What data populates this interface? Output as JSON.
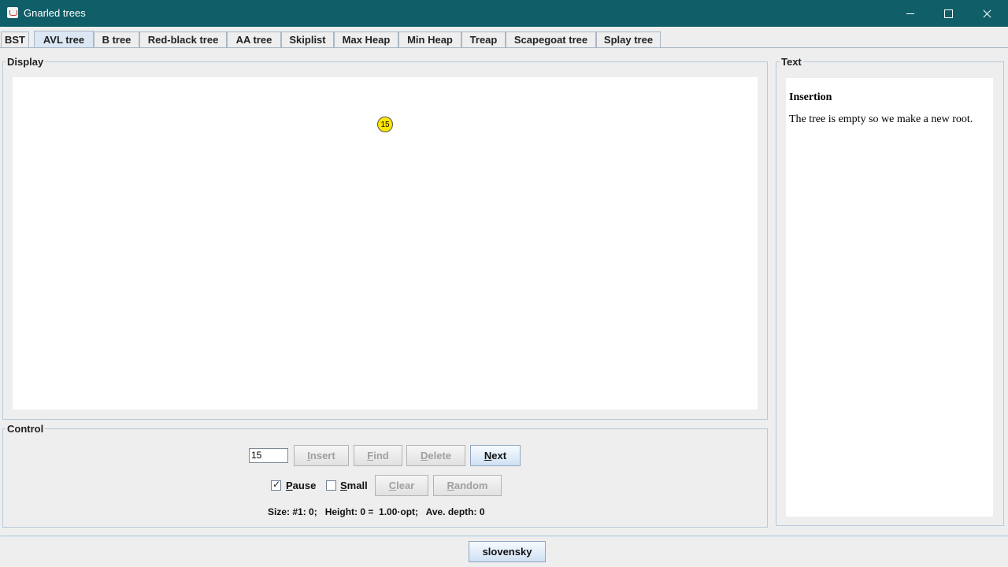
{
  "window": {
    "title": "Gnarled trees"
  },
  "tabs": [
    {
      "label": "BST"
    },
    {
      "label": "AVL tree"
    },
    {
      "label": "B tree"
    },
    {
      "label": "Red-black tree"
    },
    {
      "label": "AA tree"
    },
    {
      "label": "Skiplist"
    },
    {
      "label": "Max Heap"
    },
    {
      "label": "Min Heap"
    },
    {
      "label": "Treap"
    },
    {
      "label": "Scapegoat tree"
    },
    {
      "label": "Splay tree"
    }
  ],
  "active_tab": "AVL tree",
  "display": {
    "title": "Display",
    "nodes": [
      {
        "value": "15",
        "color": "#ffe500"
      }
    ]
  },
  "text_panel": {
    "title": "Text",
    "heading": "Insertion",
    "body": "The tree is empty so we make a new root."
  },
  "control": {
    "title": "Control",
    "input_value": "15",
    "buttons": {
      "insert": {
        "pre": "",
        "key": "I",
        "post": "nsert",
        "enabled": false
      },
      "find": {
        "pre": "",
        "key": "F",
        "post": "ind",
        "enabled": false
      },
      "delete": {
        "pre": "",
        "key": "D",
        "post": "elete",
        "enabled": false
      },
      "next": {
        "pre": "",
        "key": "N",
        "post": "ext",
        "enabled": true
      },
      "clear": {
        "pre": "",
        "key": "C",
        "post": "lear",
        "enabled": false
      },
      "random": {
        "pre": "",
        "key": "R",
        "post": "andom",
        "enabled": false
      }
    },
    "checkboxes": {
      "pause": {
        "key": "P",
        "post": "ause",
        "checked": true
      },
      "small": {
        "key": "S",
        "post": "mall",
        "checked": false
      }
    },
    "status": "Size: #1: 0;   Height: 0 =  1.00·opt;   Ave. depth: 0"
  },
  "language_button": "slovensky"
}
